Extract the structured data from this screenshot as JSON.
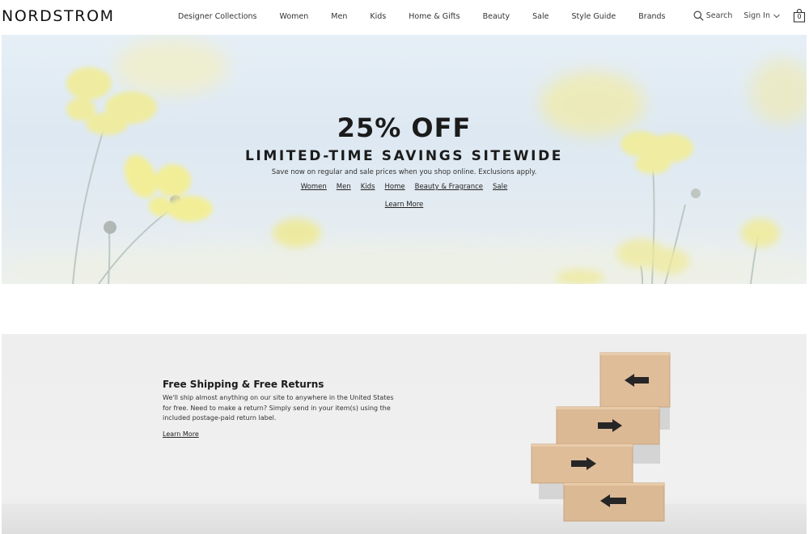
{
  "header": {
    "logo": "NORDSTROM",
    "nav": [
      "Designer Collections",
      "Women",
      "Men",
      "Kids",
      "Home & Gifts",
      "Beauty",
      "Sale",
      "Style Guide",
      "Brands"
    ],
    "search_label": "Search",
    "signin_label": "Sign In",
    "bag_count": "0"
  },
  "hero": {
    "title": "25% OFF",
    "subtitle": "LIMITED-TIME SAVINGS SITEWIDE",
    "description": "Save now on regular and sale prices when you shop online. Exclusions apply.",
    "links": [
      "Women",
      "Men",
      "Kids",
      "Home",
      "Beauty & Fragrance",
      "Sale"
    ],
    "learn_more": "Learn More"
  },
  "promo": {
    "title": "Free Shipping & Free Returns",
    "body": "We'll ship almost anything on our site to anywhere in the United States for free. Need to make a return? Simply send in your item(s) using the included postage-paid return label.",
    "learn_more": "Learn More"
  },
  "colors": {
    "flower": "#f0ec9c",
    "sky": "#dde8f2",
    "box": "#dfbd99",
    "arrow": "#222222"
  }
}
